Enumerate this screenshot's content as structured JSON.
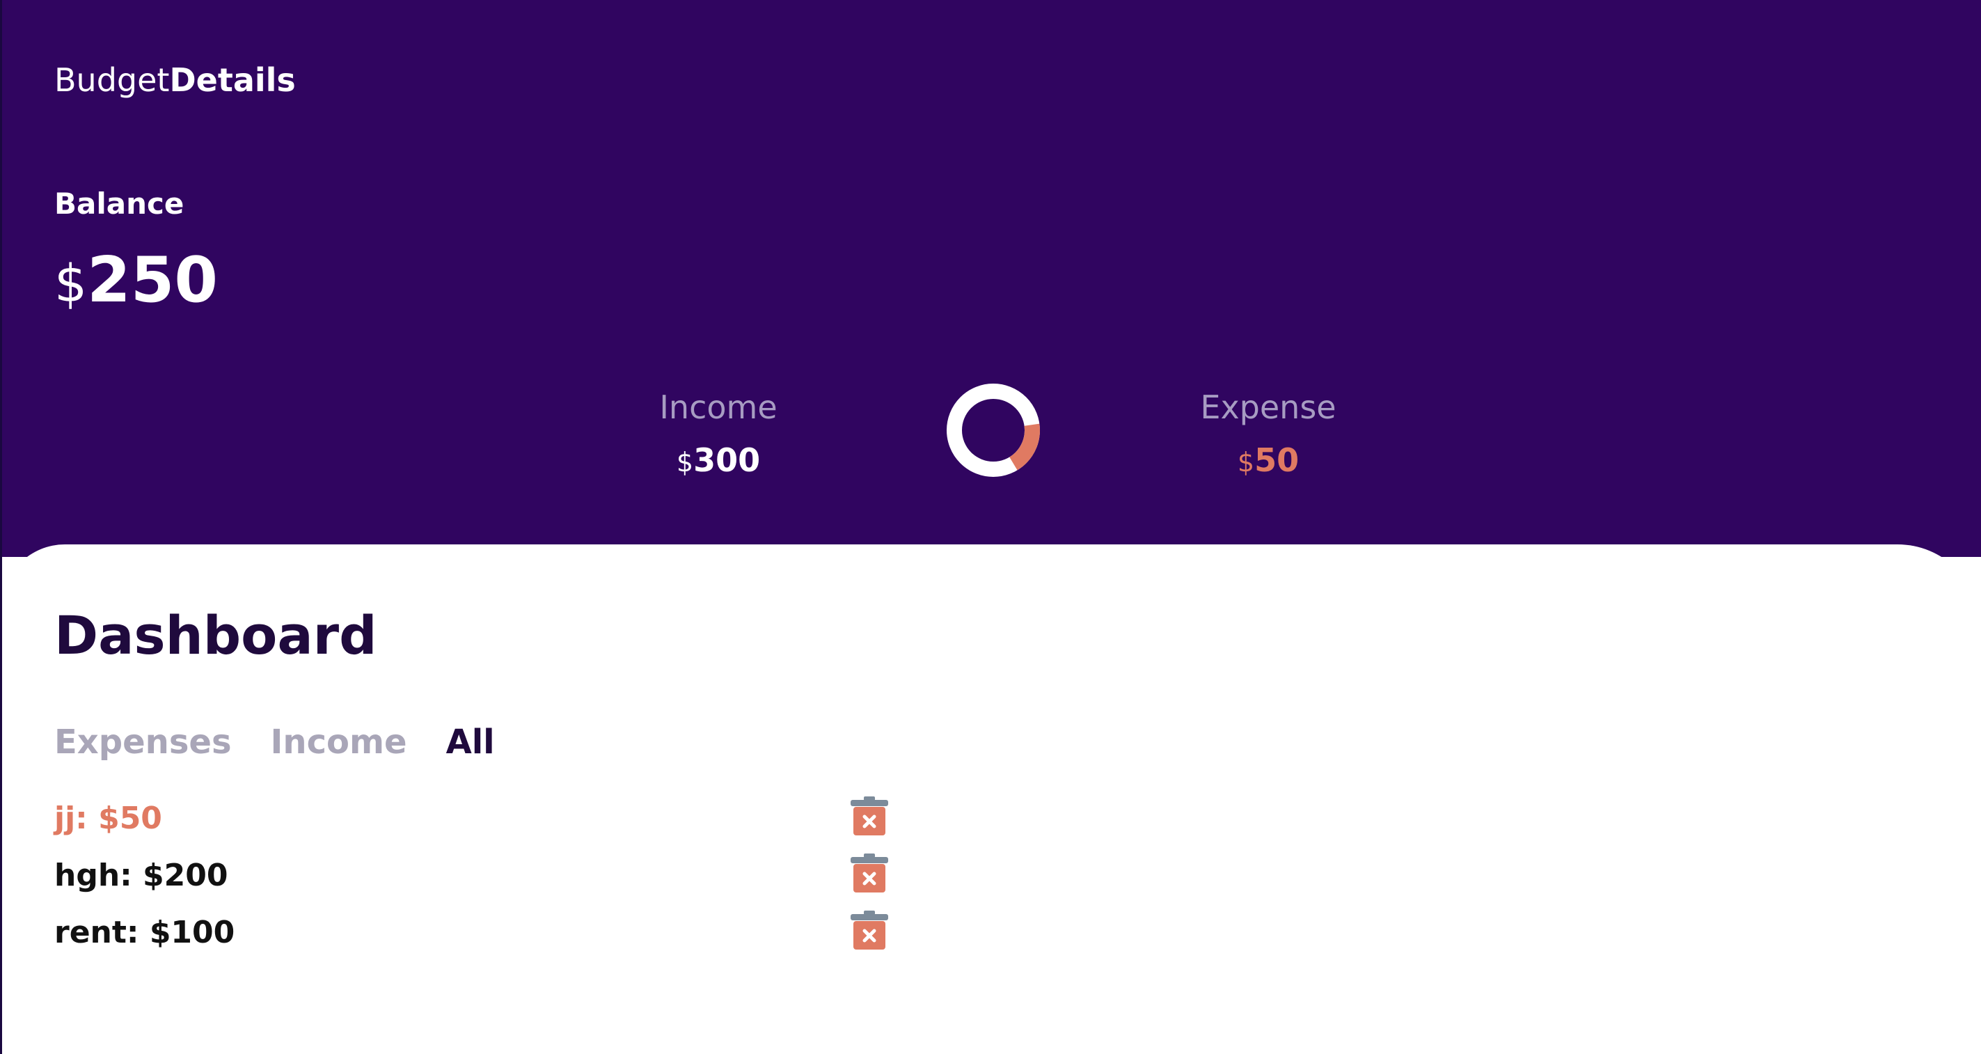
{
  "header": {
    "logo_light": "Budget",
    "logo_bold": "Details",
    "balance_label": "Balance",
    "balance_currency": "$",
    "balance_amount": "250"
  },
  "stats": {
    "income": {
      "label": "Income",
      "currency": "$",
      "amount": "300"
    },
    "expense": {
      "label": "Expense",
      "currency": "$",
      "amount": "50"
    }
  },
  "donut": {
    "income": 300,
    "expense": 50,
    "income_color": "#ffffff",
    "expense_color": "#e07a62"
  },
  "dashboard": {
    "title": "Dashboard",
    "tabs": [
      {
        "label": "Expenses",
        "active": false
      },
      {
        "label": "Income",
        "active": false
      },
      {
        "label": "All",
        "active": true
      }
    ],
    "items": [
      {
        "text": "jj: $50",
        "type": "expense"
      },
      {
        "text": "hgh: $200",
        "type": "income"
      },
      {
        "text": "rent: $100",
        "type": "income"
      }
    ]
  },
  "colors": {
    "header_bg": "#300560",
    "accent": "#e07a62",
    "muted_label": "#a79cc2",
    "title": "#1f0a3d",
    "tab_inactive": "#a9a6b8",
    "trash_body": "#e07a62",
    "trash_lid": "#7c8b9a"
  },
  "icons": {
    "delete": "trash-icon"
  }
}
